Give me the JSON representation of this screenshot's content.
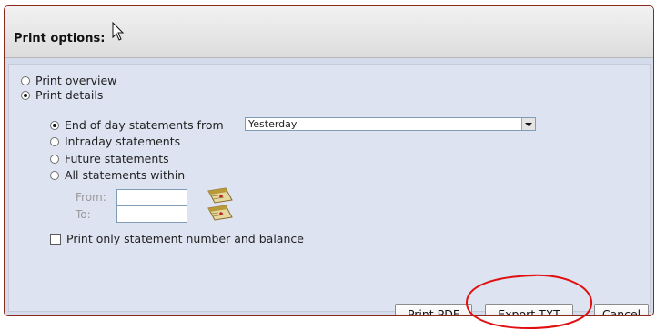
{
  "dialog": {
    "title": "Print options:"
  },
  "options": {
    "print_overview": "Print overview",
    "print_details": "Print details",
    "selected": "print_details"
  },
  "details": {
    "end_of_day": "End of day statements from",
    "intraday": "Intraday statements",
    "future": "Future statements",
    "all_within": "All statements within",
    "selected": "end_of_day",
    "period": {
      "value": "Yesterday"
    },
    "from_label": "From:",
    "to_label": "To:",
    "from_value": "",
    "to_value": ""
  },
  "checkbox": {
    "label": "Print only statement number and balance",
    "checked": false
  },
  "buttons": {
    "print_pdf": "Print PDF",
    "export_txt": "Export TXT",
    "cancel": "Cancel"
  },
  "icons": {
    "cursor": "arrow-cursor-icon",
    "calendar": "calendar-icon",
    "highlight": "red-circle-annotation"
  },
  "colors": {
    "panel_bg": "#d4dceb",
    "border": "#8a2a1e",
    "annotation": "#e01010"
  }
}
